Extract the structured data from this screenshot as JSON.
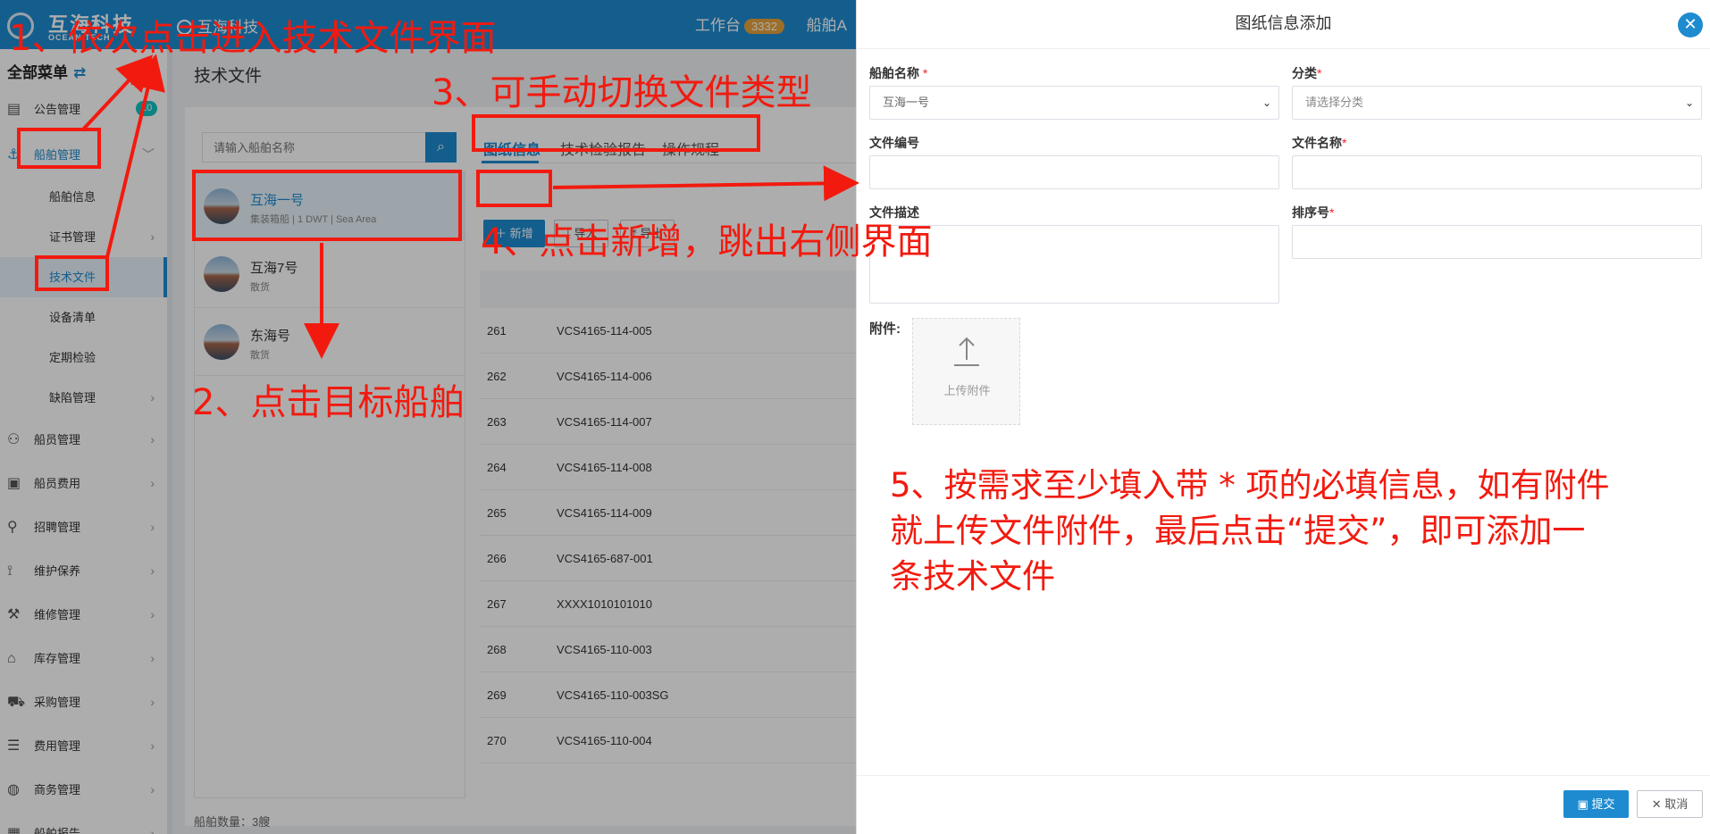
{
  "header": {
    "logo_name": "互海科技",
    "logo_sub": "OCEAN TECH",
    "org_name": "互海科技",
    "workbench_label": "工作台",
    "workbench_count": "3332",
    "ship_menu_label": "船舶A"
  },
  "sidebar": {
    "title": "全部菜单",
    "items": [
      {
        "label": "公告管理",
        "icon": "book-icon",
        "badge": "10"
      },
      {
        "label": "船舶管理",
        "icon": "anchor-icon"
      },
      {
        "label": "船舶信息"
      },
      {
        "label": "证书管理"
      },
      {
        "label": "技术文件"
      },
      {
        "label": "设备清单"
      },
      {
        "label": "定期检验"
      },
      {
        "label": "缺陷管理"
      },
      {
        "label": "船员管理",
        "icon": "user-icon"
      },
      {
        "label": "船员费用",
        "icon": "wallet-icon"
      },
      {
        "label": "招聘管理",
        "icon": "recruit-icon"
      },
      {
        "label": "维护保养",
        "icon": "maintain-icon"
      },
      {
        "label": "维修管理",
        "icon": "wrench-icon"
      },
      {
        "label": "库存管理",
        "icon": "home-icon"
      },
      {
        "label": "采购管理",
        "icon": "cart-icon"
      },
      {
        "label": "费用管理",
        "icon": "coins-icon"
      },
      {
        "label": "商务管理",
        "icon": "globe-icon"
      },
      {
        "label": "船舶报告",
        "icon": "report-icon"
      }
    ]
  },
  "page": {
    "title": "技术文件",
    "search_placeholder": "请输入船舶名称",
    "ships": [
      {
        "name": "互海一号",
        "meta": "集装箱船 | 1 DWT | Sea Area"
      },
      {
        "name": "互海7号",
        "meta": "散货"
      },
      {
        "name": "东海号",
        "meta": "散货"
      }
    ],
    "ship_count": "船舶数量：3艘",
    "tabs": [
      "图纸信息",
      "技术检验报告",
      "操作规程"
    ],
    "add_label": "新增",
    "import_label": "导入",
    "export_label": "导出",
    "rows": [
      {
        "no": "261",
        "code": "VCS4165-114-005"
      },
      {
        "no": "262",
        "code": "VCS4165-114-006"
      },
      {
        "no": "263",
        "code": "VCS4165-114-007"
      },
      {
        "no": "264",
        "code": "VCS4165-114-008"
      },
      {
        "no": "265",
        "code": "VCS4165-114-009"
      },
      {
        "no": "266",
        "code": "VCS4165-687-001"
      },
      {
        "no": "267",
        "code": "XXXX1010101010"
      },
      {
        "no": "268",
        "code": "VCS4165-110-003"
      },
      {
        "no": "269",
        "code": "VCS4165-110-003SG"
      },
      {
        "no": "270",
        "code": "VCS4165-110-004"
      }
    ]
  },
  "drawer": {
    "title": "图纸信息添加",
    "ship_name_label": "船舶名称",
    "ship_name_value": "互海一号",
    "category_label": "分类",
    "category_placeholder": "请选择分类",
    "file_no_label": "文件编号",
    "file_name_label": "文件名称",
    "desc_label": "文件描述",
    "sort_label": "排序号",
    "attach_label": "附件:",
    "upload_label": "上传附件",
    "required_mark": "*",
    "submit_label": "提交",
    "cancel_label": "取消"
  },
  "annotations": {
    "a1": "1、依次点击进入技术文件界面",
    "a2": "2、点击目标船舶",
    "a3": "3、可手动切换文件类型",
    "a4": "4、点击新增，跳出右侧界面",
    "a5_line1": "5、按需求至少填入带 * 项的必填信息，如有附件",
    "a5_line2": "就上传文件附件，最后点击“提交”，即可添加一",
    "a5_line3": "条技术文件"
  },
  "colors": {
    "brand": "#1e8bd0",
    "annotation": "#f21a0f"
  }
}
